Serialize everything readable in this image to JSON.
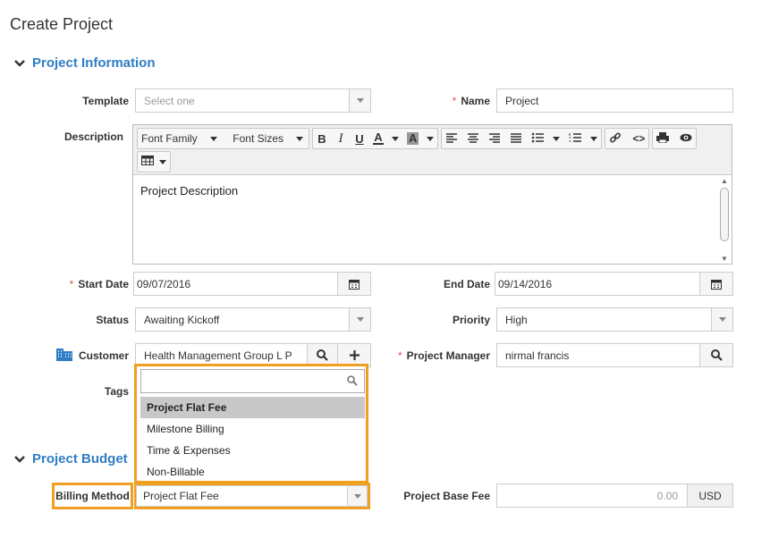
{
  "page_title": "Create Project",
  "sections": {
    "info": "Project Information",
    "budget": "Project Budget"
  },
  "labels": {
    "template": "Template",
    "name": "Name",
    "description": "Description",
    "start_date": "Start Date",
    "end_date": "End Date",
    "status": "Status",
    "priority": "Priority",
    "customer": "Customer",
    "project_manager": "Project Manager",
    "tags": "Tags",
    "billing_method": "Billing Method",
    "project_base_fee": "Project Base Fee",
    "required_mark": "*"
  },
  "fields": {
    "template_placeholder": "Select one",
    "name_value": "Project",
    "start_date": "09/07/2016",
    "end_date": "09/14/2016",
    "status": "Awaiting Kickoff",
    "priority": "High",
    "customer": "Health Management Group L P",
    "project_manager": "nirmal francis",
    "billing_method": "Project Flat Fee",
    "base_fee": "0.00",
    "currency": "USD"
  },
  "editor": {
    "font_family": "Font Family",
    "font_sizes": "Font Sizes",
    "content": "Project Description"
  },
  "dropdown": {
    "options": [
      "Project Flat Fee",
      "Milestone Billing",
      "Time & Expenses",
      "Non-Billable"
    ],
    "selected_index": 0
  },
  "colors": {
    "accent": "#2f7dc4",
    "highlight": "#f0a020",
    "required": "#d9534f"
  }
}
